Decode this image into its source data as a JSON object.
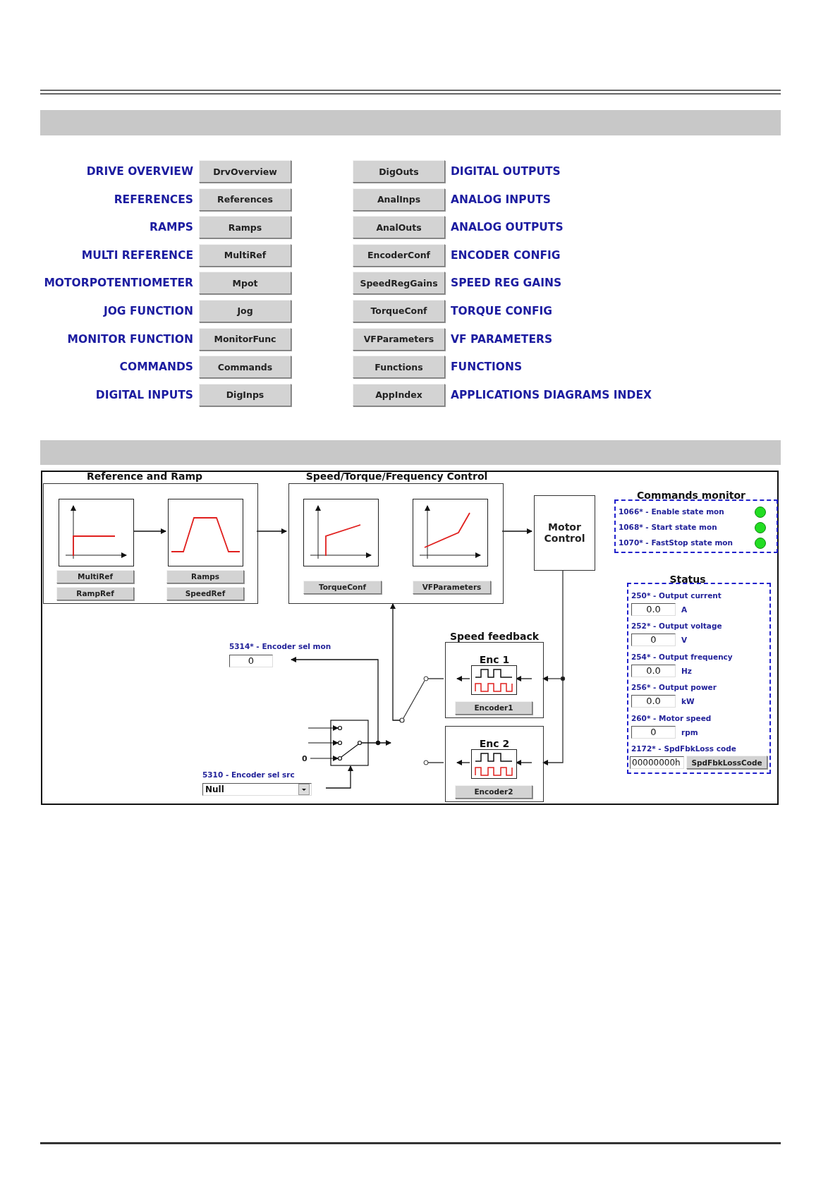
{
  "nav": {
    "left": [
      {
        "label": "DRIVE OVERVIEW",
        "button": "DrvOverview"
      },
      {
        "label": "REFERENCES",
        "button": "References"
      },
      {
        "label": "RAMPS",
        "button": "Ramps"
      },
      {
        "label": "MULTI REFERENCE",
        "button": "MultiRef"
      },
      {
        "label": "MOTORPOTENTIOMETER",
        "button": "Mpot"
      },
      {
        "label": "JOG FUNCTION",
        "button": "Jog"
      },
      {
        "label": "MONITOR FUNCTION",
        "button": "MonitorFunc"
      },
      {
        "label": "COMMANDS",
        "button": "Commands"
      },
      {
        "label": "DIGITAL INPUTS",
        "button": "DigInps"
      }
    ],
    "right": [
      {
        "label": "DIGITAL OUTPUTS",
        "button": "DigOuts"
      },
      {
        "label": "ANALOG INPUTS",
        "button": "AnalInps"
      },
      {
        "label": "ANALOG OUTPUTS",
        "button": "AnalOuts"
      },
      {
        "label": "ENCODER CONFIG",
        "button": "EncoderConf"
      },
      {
        "label": "SPEED REG GAINS",
        "button": "SpeedRegGains"
      },
      {
        "label": "TORQUE CONFIG",
        "button": "TorqueConf"
      },
      {
        "label": "VF PARAMETERS",
        "button": "VFParameters"
      },
      {
        "label": "FUNCTIONS",
        "button": "Functions"
      },
      {
        "label": "APPLICATIONS DIAGRAMS INDEX",
        "button": "AppIndex"
      }
    ]
  },
  "diagram": {
    "reference_and_ramp": {
      "title": "Reference and Ramp",
      "buttons": [
        "MultiRef",
        "Ramps",
        "RampRef",
        "SpeedRef"
      ]
    },
    "control": {
      "title": "Speed/Torque/Frequency Control",
      "buttons": [
        "TorqueConf",
        "VFParameters"
      ]
    },
    "motor_control": "Motor Control",
    "commands_monitor": {
      "title": "Commands monitor",
      "items": [
        {
          "label": "1066* - Enable state mon",
          "on": true
        },
        {
          "label": "1068* - Start state mon",
          "on": true
        },
        {
          "label": "1070* - FastStop state mon",
          "on": true
        }
      ]
    },
    "status": {
      "title": "Status",
      "items": [
        {
          "kind": "reading",
          "label": "250* - Output current",
          "value": "0.0",
          "unit": "A"
        },
        {
          "kind": "reading",
          "label": "252* - Output voltage",
          "value": "0",
          "unit": "V"
        },
        {
          "kind": "reading",
          "label": "254* - Output frequency",
          "value": "0.0",
          "unit": "Hz"
        },
        {
          "kind": "reading",
          "label": "256* - Output power",
          "value": "0.0",
          "unit": "kW"
        },
        {
          "kind": "reading",
          "label": "260* - Motor speed",
          "value": "0",
          "unit": "rpm"
        },
        {
          "kind": "code",
          "label": "2172* - SpdFbkLoss code",
          "value": "00000000h",
          "button": "SpdFbkLossCode"
        }
      ]
    },
    "speed_feedback": {
      "title": "Speed feedback",
      "encoders": [
        {
          "title": "Enc 1",
          "button": "Encoder1"
        },
        {
          "title": "Enc 2",
          "button": "Encoder2"
        }
      ]
    },
    "encoder_sel_mon": {
      "label": "5314* - Encoder sel mon",
      "value": "0"
    },
    "selector_input": "0",
    "encoder_sel_src": {
      "label": "5310 - Encoder sel src",
      "value": "Null"
    }
  }
}
